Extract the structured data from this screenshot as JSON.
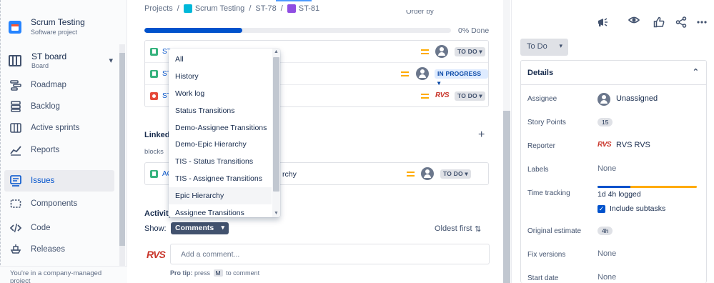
{
  "project": {
    "name": "Scrum Testing",
    "type": "Software project"
  },
  "board": {
    "name": "ST board",
    "sub": "Board"
  },
  "nav": {
    "roadmap": "Roadmap",
    "backlog": "Backlog",
    "active_sprints": "Active sprints",
    "reports": "Reports",
    "issues": "Issues",
    "components": "Components",
    "code": "Code",
    "releases": "Releases"
  },
  "sidebar_footer": "You're in a company-managed project",
  "breadcrumb": {
    "projects": "Projects",
    "project": "Scrum Testing",
    "parent": "ST-78",
    "issue": "ST-81",
    "sep": "/"
  },
  "order_by": "Order by",
  "progress": {
    "label": "0% Done",
    "done_fraction": 0.32
  },
  "children": [
    {
      "key": "ST",
      "type": "story",
      "status": "TO DO ▾",
      "assignee": "avatar"
    },
    {
      "key": "ST",
      "type": "story",
      "status": "IN PROGRESS ▾",
      "assignee": "avatar"
    },
    {
      "key": "ST",
      "type": "bug",
      "status": "TO DO ▾",
      "assignee": "RVS"
    }
  ],
  "linked": {
    "title": "Linked",
    "relation": "blocks",
    "key": "AC",
    "summary_tail": "rchy",
    "status": "TO DO ▾",
    "plus": "+"
  },
  "activity": {
    "title": "Activity",
    "show_label": "Show:",
    "selected": "Comments",
    "sort_label": "Oldest first",
    "sort_icon": "⇅",
    "comment_placeholder": "Add a comment...",
    "commenter": "RVS",
    "pro_tip_bold": "Pro tip:",
    "pro_tip_pre": "press",
    "pro_tip_key": "M",
    "pro_tip_post": "to comment"
  },
  "dropdown": {
    "items": [
      "All",
      "History",
      "Work log",
      "Status Transitions",
      "Demo-Assignee Transitions",
      "Demo-Epic Hierarchy",
      "TIS - Status Transitions",
      "TIS - Assignee Transitions",
      "Epic Hierarchy",
      "Assignee Transitions"
    ],
    "hovered": "Epic Hierarchy"
  },
  "right_panel": {
    "status_button": "To Do",
    "details_title": "Details",
    "fields": {
      "assignee_label": "Assignee",
      "assignee_value": "Unassigned",
      "story_points_label": "Story Points",
      "story_points_value": "15",
      "reporter_label": "Reporter",
      "reporter_value": "RVS RVS",
      "reporter_logo": "RVS",
      "labels_label": "Labels",
      "labels_value": "None",
      "time_tracking_label": "Time tracking",
      "time_logged": "1d 4h logged",
      "time_logged_fraction": 0.33,
      "include_subtasks": "Include subtasks",
      "original_estimate_label": "Original estimate",
      "original_estimate_value": "4h",
      "fix_versions_label": "Fix versions",
      "fix_versions_value": "None",
      "start_date_label": "Start date",
      "start_date_value": "None"
    }
  },
  "colors": {
    "brand": "#0052cc",
    "priority_medium": "#ffab00",
    "story": "#36b37e",
    "bug": "#e5493a",
    "rvs": "#c9372c"
  }
}
